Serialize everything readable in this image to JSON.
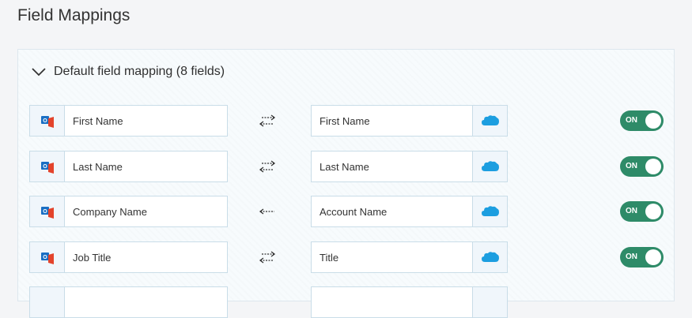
{
  "page": {
    "title": "Field Mappings"
  },
  "section": {
    "title": "Default field mapping (8 fields)",
    "expanded": true
  },
  "colors": {
    "toggle_on": "#2e8b68",
    "outlook_blue": "#1a6fc4",
    "office_red": "#e3432b",
    "salesforce_blue": "#1c9ee0"
  },
  "mappings": [
    {
      "source": "First Name",
      "target": "First Name",
      "direction": "bidirectional",
      "toggle": "ON",
      "source_icon": "outlook-icon",
      "target_icon": "salesforce-icon"
    },
    {
      "source": "Last Name",
      "target": "Last Name",
      "direction": "bidirectional",
      "toggle": "ON",
      "source_icon": "outlook-icon",
      "target_icon": "salesforce-icon"
    },
    {
      "source": "Company Name",
      "target": "Account Name",
      "direction": "target-to-source",
      "toggle": "ON",
      "source_icon": "outlook-icon",
      "target_icon": "salesforce-icon"
    },
    {
      "source": "Job Title",
      "target": "Title",
      "direction": "bidirectional",
      "toggle": "ON",
      "source_icon": "outlook-icon",
      "target_icon": "salesforce-icon"
    },
    {
      "source": "",
      "target": "",
      "direction": "",
      "toggle": "",
      "source_icon": "outlook-icon",
      "target_icon": "salesforce-icon"
    }
  ]
}
